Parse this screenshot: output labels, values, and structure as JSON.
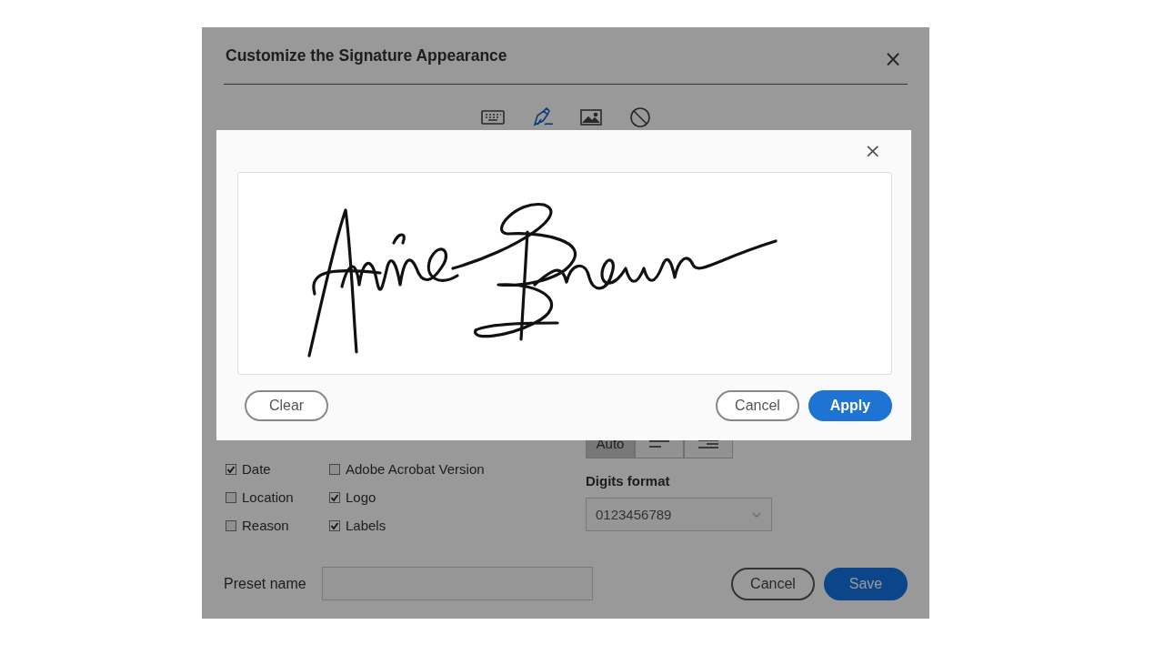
{
  "dialog": {
    "title": "Customize the Signature Appearance",
    "close": "×",
    "modes": [
      {
        "kind": "keyboard",
        "selected": false
      },
      {
        "kind": "draw",
        "selected": true
      },
      {
        "kind": "image",
        "selected": false
      },
      {
        "kind": "none",
        "selected": false
      }
    ],
    "options_left": [
      {
        "label": "Date",
        "checked": true
      },
      {
        "label": "Location",
        "checked": false
      },
      {
        "label": "Reason",
        "checked": false
      }
    ],
    "options_right": [
      {
        "label": "Adobe Acrobat Version",
        "checked": false
      },
      {
        "label": "Logo",
        "checked": true
      },
      {
        "label": "Labels",
        "checked": true
      }
    ],
    "alignment": [
      {
        "kind": "text",
        "label": "Auto",
        "selected": true
      },
      {
        "kind": "align-left",
        "selected": false
      },
      {
        "kind": "align-right",
        "selected": false
      }
    ],
    "digits_format": {
      "label": "Digits format",
      "value": "0123456789"
    },
    "preset_name": {
      "label": "Preset name"
    },
    "buttons": [
      {
        "kind": "secondary",
        "label": "Cancel"
      },
      {
        "kind": "primary",
        "label": "Save"
      }
    ]
  },
  "draw_popup": {
    "close": "×",
    "left_buttons": [
      {
        "label": "Clear"
      }
    ],
    "right_buttons": [
      {
        "kind": "secondary",
        "label": "Cancel"
      },
      {
        "kind": "primary",
        "label": "Apply"
      }
    ]
  }
}
